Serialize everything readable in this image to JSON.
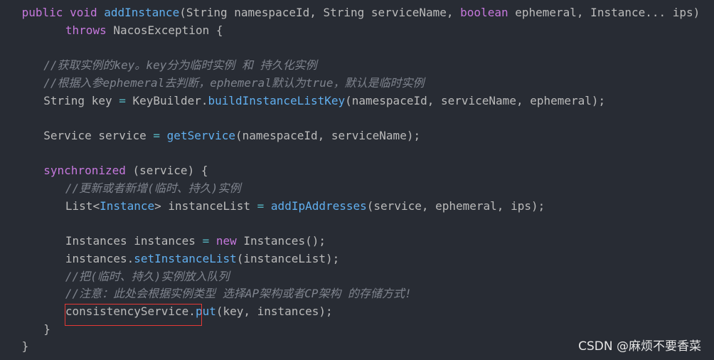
{
  "code": {
    "lines": [
      {
        "indent": 4,
        "segments": [
          {
            "t": "public ",
            "c": "kw"
          },
          {
            "t": "void ",
            "c": "kw"
          },
          {
            "t": "addInstance",
            "c": "fn"
          },
          {
            "t": "(String namespaceId, String serviceName, ",
            "c": "pl"
          },
          {
            "t": "boolean ",
            "c": "kw"
          },
          {
            "t": "ephemeral, Instance... ips)",
            "c": "pl"
          }
        ]
      },
      {
        "indent": 12,
        "segments": [
          {
            "t": "throws ",
            "c": "kw"
          },
          {
            "t": "NacosException {",
            "c": "pl"
          }
        ]
      },
      {
        "indent": 0,
        "segments": []
      },
      {
        "indent": 8,
        "segments": [
          {
            "t": "//获取实例的key。key分为临时实例 和 持久化实例",
            "c": "cm"
          }
        ]
      },
      {
        "indent": 8,
        "segments": [
          {
            "t": "//根据入参ephemeral去判断，ephemeral默认为true，默认是临时实例",
            "c": "cm"
          }
        ]
      },
      {
        "indent": 8,
        "segments": [
          {
            "t": "String key ",
            "c": "pl"
          },
          {
            "t": "=",
            "c": "op"
          },
          {
            "t": " KeyBuilder.",
            "c": "pl"
          },
          {
            "t": "buildInstanceListKey",
            "c": "fn"
          },
          {
            "t": "(namespaceId, serviceName, ephemeral);",
            "c": "pl"
          }
        ]
      },
      {
        "indent": 0,
        "segments": []
      },
      {
        "indent": 8,
        "segments": [
          {
            "t": "Service service ",
            "c": "pl"
          },
          {
            "t": "=",
            "c": "op"
          },
          {
            "t": " ",
            "c": "pl"
          },
          {
            "t": "getService",
            "c": "fn"
          },
          {
            "t": "(namespaceId, serviceName);",
            "c": "pl"
          }
        ]
      },
      {
        "indent": 0,
        "segments": []
      },
      {
        "indent": 8,
        "segments": [
          {
            "t": "synchronized ",
            "c": "kw"
          },
          {
            "t": "(service) {",
            "c": "pl"
          }
        ]
      },
      {
        "indent": 12,
        "segments": [
          {
            "t": "//更新或者新增(临时、持久)实例",
            "c": "cm"
          }
        ]
      },
      {
        "indent": 12,
        "segments": [
          {
            "t": "List<",
            "c": "pl"
          },
          {
            "t": "Instance",
            "c": "ty"
          },
          {
            "t": "> instanceList ",
            "c": "pl"
          },
          {
            "t": "=",
            "c": "op"
          },
          {
            "t": " ",
            "c": "pl"
          },
          {
            "t": "addIpAddresses",
            "c": "fn"
          },
          {
            "t": "(service, ephemeral, ips);",
            "c": "pl"
          }
        ]
      },
      {
        "indent": 0,
        "segments": []
      },
      {
        "indent": 12,
        "segments": [
          {
            "t": "Instances instances ",
            "c": "pl"
          },
          {
            "t": "=",
            "c": "op"
          },
          {
            "t": " ",
            "c": "pl"
          },
          {
            "t": "new ",
            "c": "kw"
          },
          {
            "t": "Instances();",
            "c": "pl"
          }
        ]
      },
      {
        "indent": 12,
        "segments": [
          {
            "t": "instances.",
            "c": "pl"
          },
          {
            "t": "setInstanceList",
            "c": "fn"
          },
          {
            "t": "(instanceList);",
            "c": "pl"
          }
        ]
      },
      {
        "indent": 12,
        "segments": [
          {
            "t": "//把(临时、持久)实例放入队列",
            "c": "cm"
          }
        ]
      },
      {
        "indent": 12,
        "segments": [
          {
            "t": "//注意：此处会根据实例类型 选择AP架构或者CP架构 的存储方式!",
            "c": "cm"
          }
        ]
      },
      {
        "indent": 12,
        "segments": [
          {
            "t": "consistencyService.",
            "c": "pl"
          },
          {
            "t": "put",
            "c": "fn"
          },
          {
            "t": "(key, instances);",
            "c": "pl"
          }
        ]
      },
      {
        "indent": 8,
        "segments": [
          {
            "t": "}",
            "c": "pl"
          }
        ]
      },
      {
        "indent": 4,
        "segments": [
          {
            "t": "}",
            "c": "pl"
          }
        ]
      }
    ]
  },
  "watermark": "CSDN @麻烦不要香菜",
  "colors": {
    "background": "#282c34",
    "keyword": "#c678dd",
    "function": "#61afef",
    "operator": "#56b6c2",
    "comment": "#7f848e",
    "plain": "#bbbbbb",
    "highlight_border": "#e53935"
  }
}
